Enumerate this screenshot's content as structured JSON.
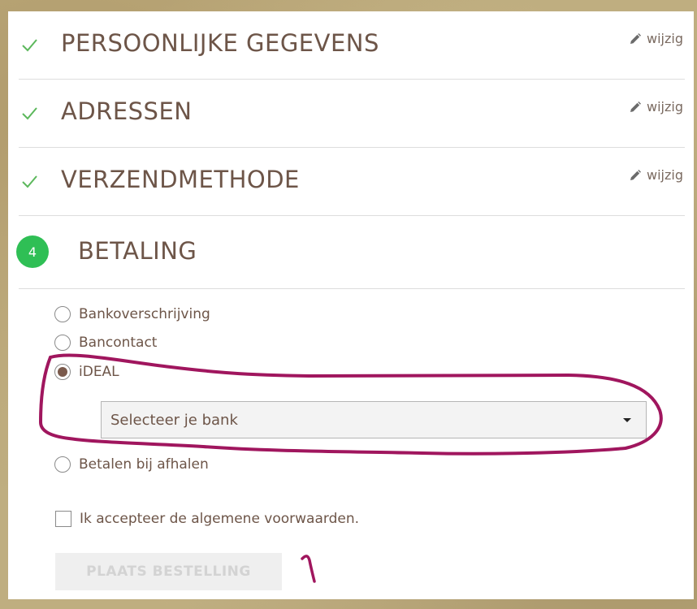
{
  "steps": [
    {
      "title": "PERSOONLIJKE GEGEVENS",
      "edit_label": "wijzig",
      "status_icon": "check-icon"
    },
    {
      "title": "ADRESSEN",
      "edit_label": "wijzig",
      "status_icon": "check-icon"
    },
    {
      "title": "VERZENDMETHODE",
      "edit_label": "wijzig",
      "status_icon": "check-icon"
    }
  ],
  "payment": {
    "step_number": "4",
    "title": "BETALING",
    "options": [
      {
        "label": "Bankoverschrijving",
        "selected": false
      },
      {
        "label": "Bancontact",
        "selected": false
      },
      {
        "label": "iDEAL",
        "selected": true
      },
      {
        "label": "Betalen bij afhalen",
        "selected": false
      }
    ],
    "bank_select": {
      "value": "Selecteer je bank"
    }
  },
  "terms": {
    "label": "Ik accepteer de algemene voorwaarden.",
    "checked": false
  },
  "submit": {
    "label": "PLAATS BESTELLING",
    "disabled": true
  },
  "annotation_text": "1",
  "colors": {
    "accent_green": "#2fbf55",
    "check_green": "#5cb85c",
    "text_brown": "#6d5548",
    "annotation_magenta": "#a0165e"
  }
}
